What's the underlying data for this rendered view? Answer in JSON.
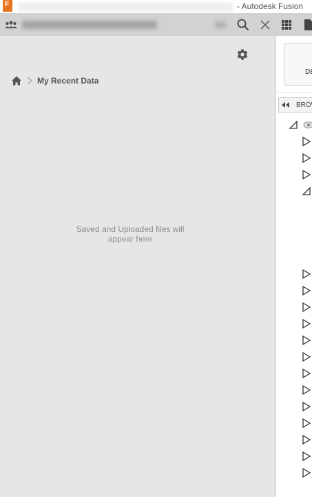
{
  "window": {
    "title": "- Autodesk Fusion",
    "app_icon_text": "F"
  },
  "toolbar": {
    "buttons": [
      "team-icon",
      "search-icon",
      "close-icon",
      "grid-icon",
      "file-icon"
    ]
  },
  "data_panel": {
    "breadcrumb": {
      "label": "My Recent Data"
    },
    "empty_message_line1": "Saved and Uploaded files will",
    "empty_message_line2": "appear here"
  },
  "right_panel": {
    "design_button_label": "DE",
    "browser_label": "BROW",
    "tree": {
      "root": "expanded",
      "items": [
        "collapsed",
        "collapsed",
        "collapsed",
        "expanded",
        "collapsed",
        "collapsed",
        "collapsed",
        "collapsed",
        "collapsed",
        "collapsed",
        "collapsed",
        "collapsed",
        "collapsed",
        "collapsed",
        "collapsed",
        "collapsed",
        "collapsed"
      ]
    }
  },
  "colors": {
    "accent": "#e8731e",
    "panel_bg": "#e6e6e6",
    "toolbar_bg": "#d2d2d2"
  }
}
